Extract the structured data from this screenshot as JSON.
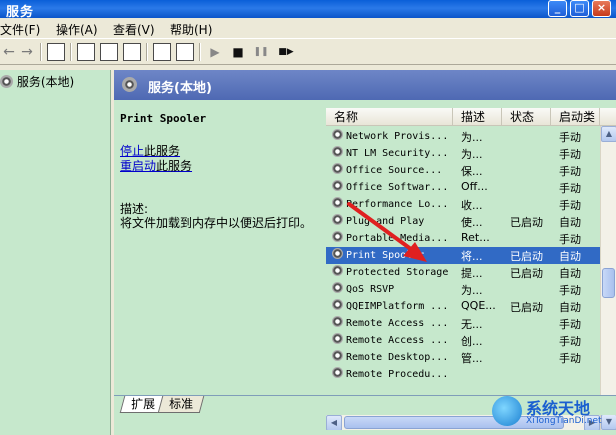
{
  "window": {
    "title": "服务",
    "min_label": "_",
    "max_label": "□",
    "close_label": "×"
  },
  "menu": [
    {
      "label": "文件(F)"
    },
    {
      "label": "操作(A)"
    },
    {
      "label": "查看(V)"
    },
    {
      "label": "帮助(H)"
    }
  ],
  "toolbar": {
    "back_glyph": "←",
    "forward_glyph": "→",
    "play_glyph": "▶",
    "stop_glyph": "■",
    "pause_glyph": "❚❚",
    "restart_glyph": "■▶"
  },
  "tree": {
    "node_label": "服务(本地)"
  },
  "panel": {
    "header": "服务(本地)"
  },
  "details": {
    "service_name": "Print Spooler",
    "stop_link": "停止",
    "stop_rest": "此服务",
    "restart_link": "重启动",
    "restart_rest": "此服务",
    "desc_label": "描述:",
    "desc_text": "将文件加载到内存中以便迟后打印。"
  },
  "list": {
    "columns": [
      "名称",
      "描述",
      "状态",
      "启动类"
    ],
    "rows": [
      {
        "name": "Network Provis...",
        "desc": "为...",
        "state": "",
        "startup": "手动"
      },
      {
        "name": "NT LM Security...",
        "desc": "为...",
        "state": "",
        "startup": "手动"
      },
      {
        "name": "Office  Source...",
        "desc": "保...",
        "state": "",
        "startup": "手动"
      },
      {
        "name": "Office Softwar...",
        "desc": "Off...",
        "state": "",
        "startup": "手动"
      },
      {
        "name": "Performance Lo...",
        "desc": "收...",
        "state": "",
        "startup": "手动"
      },
      {
        "name": "Plug and Play",
        "desc": "使...",
        "state": "已启动",
        "startup": "自动"
      },
      {
        "name": "Portable Media...",
        "desc": "Ret...",
        "state": "",
        "startup": "手动"
      },
      {
        "name": "Print Spooler",
        "desc": "将...",
        "state": "已启动",
        "startup": "自动",
        "selected": true
      },
      {
        "name": "Protected Storage",
        "desc": "提...",
        "state": "已启动",
        "startup": "自动"
      },
      {
        "name": "QoS RSVP",
        "desc": "为...",
        "state": "",
        "startup": "手动"
      },
      {
        "name": "QQEIMPlatform ...",
        "desc": "QQE...",
        "state": "已启动",
        "startup": "自动"
      },
      {
        "name": "Remote Access ...",
        "desc": "无...",
        "state": "",
        "startup": "手动"
      },
      {
        "name": "Remote Access ...",
        "desc": "创...",
        "state": "",
        "startup": "手动"
      },
      {
        "name": "Remote Desktop...",
        "desc": "管...",
        "state": "",
        "startup": "手动"
      },
      {
        "name": "Remote Procedu...",
        "desc": "",
        "state": "",
        "startup": ""
      }
    ]
  },
  "tabs": [
    {
      "label": "扩展"
    },
    {
      "label": "标准"
    }
  ],
  "watermark": {
    "name": "系统天地",
    "url": "XiTongTianDi.net"
  },
  "colors": {
    "accent": "#316ac5",
    "pane_bg": "#c6e8cc",
    "annotation_arrow": "#e02020"
  }
}
